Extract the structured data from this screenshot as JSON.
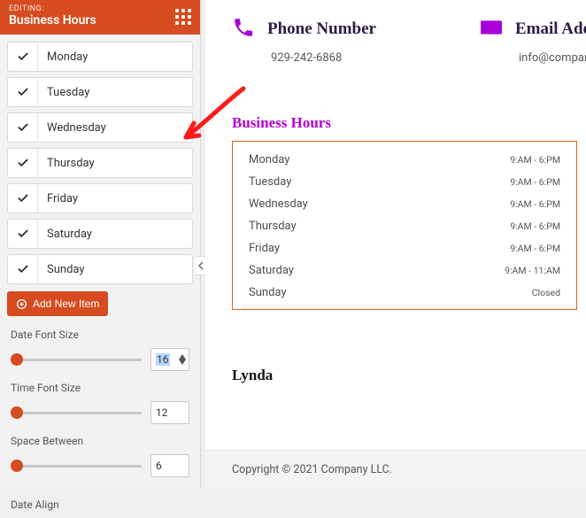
{
  "sidebar": {
    "eyebrow": "EDITING:",
    "title": "Business Hours",
    "days": [
      {
        "label": "Monday",
        "checked": true
      },
      {
        "label": "Tuesday",
        "checked": true
      },
      {
        "label": "Wednesday",
        "checked": true
      },
      {
        "label": "Thursday",
        "checked": true
      },
      {
        "label": "Friday",
        "checked": true
      },
      {
        "label": "Saturday",
        "checked": true
      },
      {
        "label": "Sunday",
        "checked": true
      }
    ],
    "add_button": "Add New Item",
    "controls": {
      "date_font_size": {
        "label": "Date Font Size",
        "value": "16"
      },
      "time_font_size": {
        "label": "Time Font Size",
        "value": "12"
      },
      "space_between": {
        "label": "Space Between",
        "value": "6"
      },
      "date_align": {
        "label": "Date Align"
      }
    }
  },
  "preview": {
    "phone": {
      "title": "Phone Number",
      "value": "929-242-6868"
    },
    "email": {
      "title": "Email Add",
      "value": "info@company.con"
    },
    "business_hours_heading": "Business Hours",
    "hours": [
      {
        "day": "Monday",
        "time": "9:AM - 6:PM"
      },
      {
        "day": "Tuesday",
        "time": "9:AM - 6:PM"
      },
      {
        "day": "Wednesday",
        "time": "9:AM - 6:PM"
      },
      {
        "day": "Thursday",
        "time": "9:AM - 6:PM"
      },
      {
        "day": "Friday",
        "time": "9:AM - 6:PM"
      },
      {
        "day": "Saturday",
        "time": "9:AM - 11:AM"
      },
      {
        "day": "Sunday",
        "time": "Closed"
      }
    ],
    "author": "Lynda",
    "footer": "Copyright © 2021 Company LLC."
  },
  "colors": {
    "accent": "#d64b1f",
    "brand_purple": "#b400d6"
  }
}
